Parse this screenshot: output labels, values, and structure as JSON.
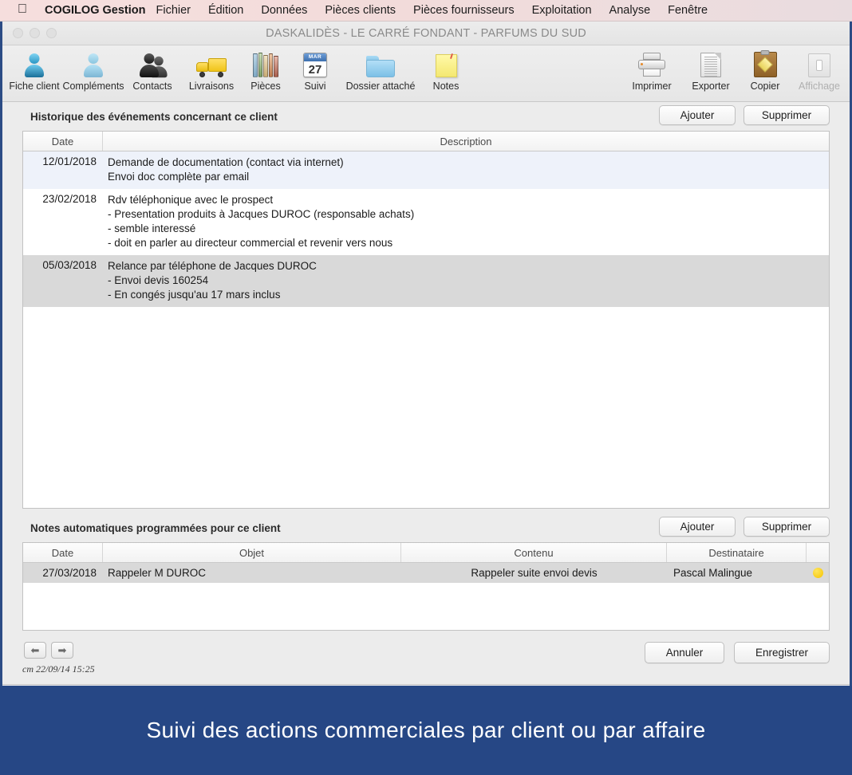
{
  "menubar": {
    "apple_icon": "apple-logo",
    "app_name": "COGILOG Gestion",
    "items": [
      {
        "label": "Fichier"
      },
      {
        "label": "Édition"
      },
      {
        "label": "Données"
      },
      {
        "label": "Pièces clients"
      },
      {
        "label": "Pièces fournisseurs"
      },
      {
        "label": "Exploitation"
      },
      {
        "label": "Analyse"
      },
      {
        "label": "Fenêtre"
      }
    ]
  },
  "window": {
    "title": "DASKALIDÈS - LE CARRÉ FONDANT - PARFUMS DU SUD"
  },
  "toolbar": {
    "left_items": [
      {
        "label": "Fiche client",
        "icon": "person-blue-icon"
      },
      {
        "label": "Compléments",
        "icon": "person-light-blue-icon"
      },
      {
        "label": "Contacts",
        "icon": "two-people-icon"
      },
      {
        "label": "Livraisons",
        "icon": "delivery-truck-icon"
      },
      {
        "label": "Pièces",
        "icon": "books-icon"
      },
      {
        "label": "Suivi",
        "icon": "calendar-icon",
        "calendar_month": "MAR",
        "calendar_day": "27"
      },
      {
        "label": "Dossier attaché",
        "icon": "folder-icon"
      },
      {
        "label": "Notes",
        "icon": "sticky-note-icon"
      }
    ],
    "right_items": [
      {
        "label": "Imprimer",
        "icon": "printer-icon",
        "disabled": false
      },
      {
        "label": "Exporter",
        "icon": "document-icon",
        "disabled": false
      },
      {
        "label": "Copier",
        "icon": "clipboard-icon",
        "disabled": false
      },
      {
        "label": "Affichage",
        "icon": "display-icon",
        "disabled": true
      }
    ]
  },
  "history_section": {
    "title": "Historique des événements concernant ce client",
    "add_button": "Ajouter",
    "delete_button": "Supprimer",
    "columns": [
      {
        "label": "Date"
      },
      {
        "label": "Description"
      }
    ],
    "rows": [
      {
        "date": "12/01/2018",
        "lines": [
          "Demande de documentation (contact via internet)",
          "Envoi doc complète par email"
        ],
        "state": "selected-blue"
      },
      {
        "date": "23/02/2018",
        "lines": [
          "Rdv téléphonique avec le prospect",
          "- Presentation produits à Jacques DUROC (responsable achats)",
          "- semble interessé",
          "- doit en parler au directeur commercial et revenir vers nous"
        ],
        "state": "normal"
      },
      {
        "date": "05/03/2018",
        "lines": [
          "Relance par téléphone de Jacques DUROC",
          "- Envoi devis 160254",
          "- En congés jusqu'au 17 mars inclus"
        ],
        "state": "selected-grey"
      }
    ]
  },
  "notes_section": {
    "title": "Notes automatiques programmées pour ce client",
    "add_button": "Ajouter",
    "delete_button": "Supprimer",
    "columns": [
      {
        "label": "Date"
      },
      {
        "label": "Objet"
      },
      {
        "label": "Contenu"
      },
      {
        "label": "Destinataire"
      },
      {
        "label": ""
      }
    ],
    "rows": [
      {
        "date": "27/03/2018",
        "objet": "Rappeler M DUROC",
        "contenu": "Rappeler suite envoi devis",
        "destinataire": "Pascal Malingue",
        "flag": "yellow-dot",
        "state": "selected-grey"
      }
    ]
  },
  "footer": {
    "prev_arrow_icon": "arrow-left-icon",
    "next_arrow_icon": "arrow-right-icon",
    "stamp": "cm 22/09/14 15:25",
    "cancel_button": "Annuler",
    "save_button": "Enregistrer"
  },
  "banner": {
    "caption": "Suivi des actions commerciales par client ou par affaire",
    "background_color": "#264785",
    "text_color": "#ffffff"
  },
  "colors": {
    "menubar_tint": "#f4dddc",
    "window_chrome": "#ececec",
    "row_selected_blue": "#eef2fa",
    "row_selected_grey": "#d9d9d9",
    "flag_yellow": "#f5c400",
    "banner_blue": "#264785"
  }
}
